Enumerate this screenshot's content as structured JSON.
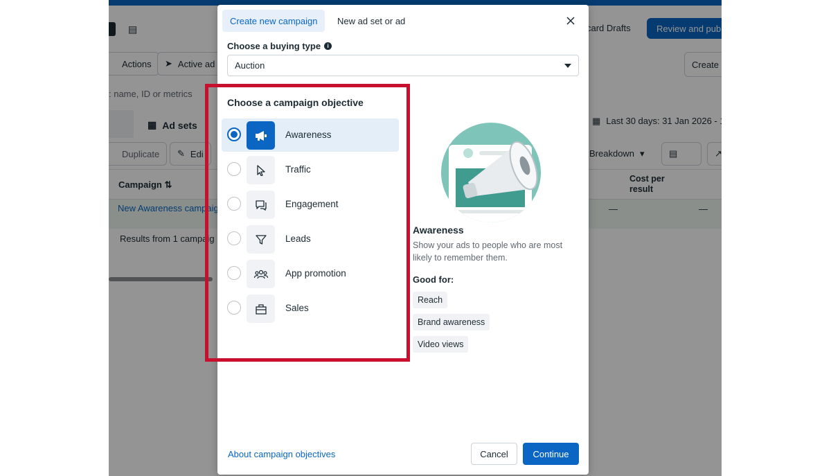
{
  "background": {
    "actions_label": "Actions",
    "active_ads_label": "Active ad",
    "search_hint": ": name, ID or metrics",
    "ad_sets_tab": "Ad sets",
    "duplicate_label": "Duplicate",
    "edit_label": "Edi",
    "campaign_header": "Campaign ⇅",
    "campaign_row": "New Awareness campaig",
    "results_row": "Results from 1 campaig",
    "discard_drafts": "card Drafts",
    "review_publish": "Review and publ",
    "create_label": "Create",
    "date_range": "Last 30 days: 31 Jan 2026 - 1",
    "breakdown_label": "Breakdown",
    "cost_per_result": "Cost per result",
    "dash1": "—",
    "dash2": "—"
  },
  "modal": {
    "tab_create": "Create new campaign",
    "tab_new_ad": "New ad set or ad",
    "buying_type_label": "Choose a buying type",
    "buying_type_value": "Auction",
    "objective_title": "Choose a campaign objective",
    "objectives": [
      {
        "label": "Awareness",
        "icon": "megaphone-icon",
        "selected": true
      },
      {
        "label": "Traffic",
        "icon": "cursor-icon",
        "selected": false
      },
      {
        "label": "Engagement",
        "icon": "chat-bubbles-icon",
        "selected": false
      },
      {
        "label": "Leads",
        "icon": "funnel-icon",
        "selected": false
      },
      {
        "label": "App promotion",
        "icon": "people-icon",
        "selected": false
      },
      {
        "label": "Sales",
        "icon": "shopping-bag-icon",
        "selected": false
      }
    ],
    "detail": {
      "title": "Awareness",
      "description": "Show your ads to people who are most likely to remember them.",
      "good_for_label": "Good for:",
      "chips": [
        "Reach",
        "Brand awareness",
        "Video views"
      ]
    },
    "about_link": "About campaign objectives",
    "cancel": "Cancel",
    "continue": "Continue"
  },
  "colors": {
    "accent": "#0a66c2",
    "highlight_border": "#c8102e",
    "illustration_teal": "#7ec4b8"
  }
}
